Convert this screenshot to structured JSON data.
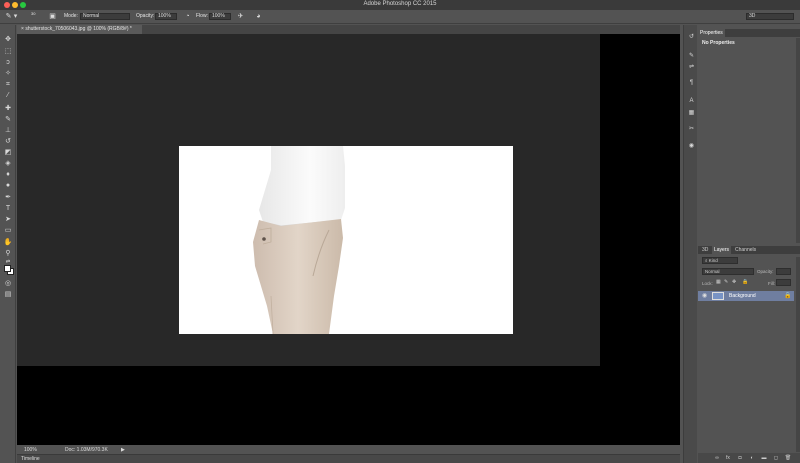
{
  "window": {
    "title": "Adobe Photoshop CC 2015"
  },
  "options_bar": {
    "brush_size": "30",
    "mode_label": "Mode:",
    "mode_value": "Normal",
    "opacity_label": "Opacity:",
    "opacity_value": "100%",
    "flow_label": "Flow:",
    "flow_value": "100%",
    "workspace_value": "3D"
  },
  "document": {
    "tab_title": "shutterstock_70506043.jpg @ 100% (RGB/8#) *",
    "zoom": "100%",
    "doc_size": "Doc: 1.03M/970.3K"
  },
  "timeline": {
    "label": "Timeline"
  },
  "properties_panel": {
    "tab": "Properties",
    "empty_text": "No Properties"
  },
  "layers_panel": {
    "tabs": [
      "3D",
      "Layers",
      "Channels"
    ],
    "filter_kind": "Kind",
    "blend_mode": "Normal",
    "opacity_label": "Opacity:",
    "lock_label": "Lock:",
    "fill_label": "Fill:",
    "layers": [
      {
        "name": "Background"
      }
    ]
  },
  "icons": {
    "tools": [
      "move-icon",
      "marquee-icon",
      "lasso-icon",
      "quick-select-icon",
      "crop-icon",
      "eyedropper-icon",
      "healing-icon",
      "brush-icon",
      "stamp-icon",
      "history-brush-icon",
      "eraser-icon",
      "gradient-icon",
      "blur-icon",
      "dodge-icon",
      "pen-icon",
      "type-icon",
      "path-select-icon",
      "rectangle-icon",
      "hand-icon",
      "zoom-icon"
    ]
  }
}
